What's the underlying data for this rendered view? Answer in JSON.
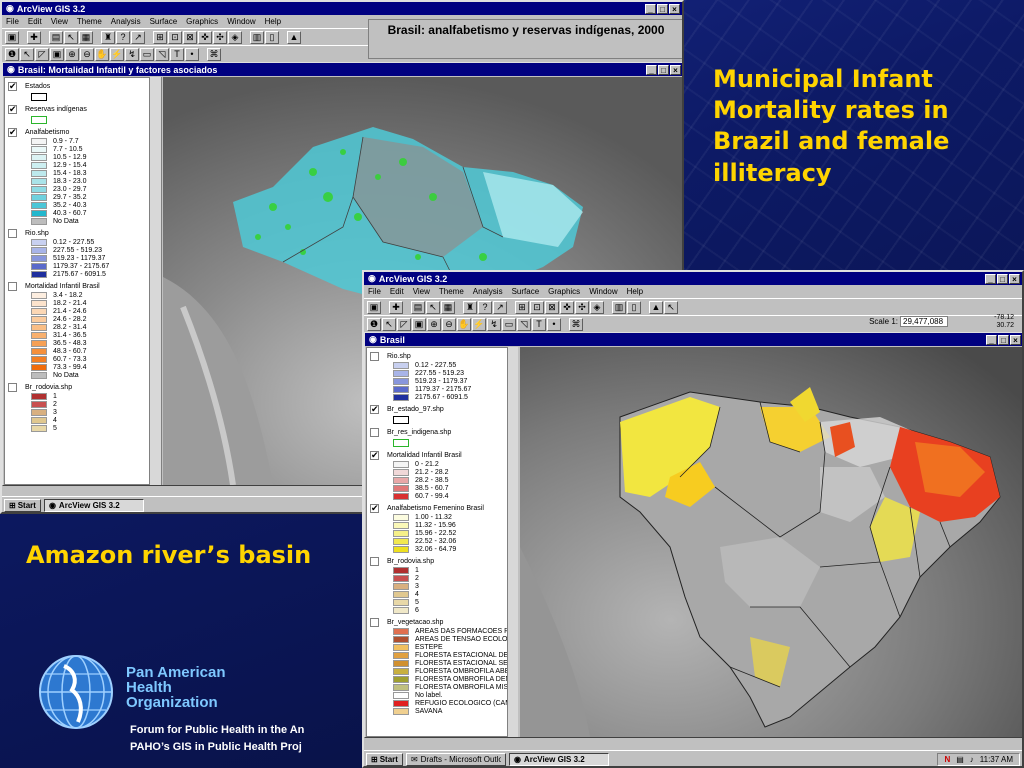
{
  "slide": {
    "heading": "Municipal Infant Mortality rates in Brazil and female illiteracy",
    "subtitle": "Amazon river’s basin",
    "org_line1": "Pan American",
    "org_line2": "Health",
    "org_line3": "Organization",
    "footer_line1": "Forum for Public Health in the An",
    "footer_line2": "PAHO’s GIS in Public Health Proj",
    "colors": {
      "text_accent": "#ffd400",
      "background": "#0d1a66",
      "org_accent": "#7ec8ff"
    }
  },
  "window1": {
    "title": "ArcView GIS 3.2",
    "menu": [
      "File",
      "Edit",
      "View",
      "Theme",
      "Analysis",
      "Surface",
      "Graphics",
      "Window",
      "Help"
    ],
    "map_title": "Brasil: analfabetismo y reservas indígenas, 2000",
    "child_title": "Brasil: Mortalidad Infantil y factores asociados",
    "legend": [
      {
        "name": "Estados",
        "checked": true,
        "symbol": "box"
      },
      {
        "name": "Reservas indígenas",
        "checked": true,
        "symbol": "green-box"
      },
      {
        "name": "Analfabetismo",
        "checked": true,
        "classes": [
          {
            "label": "0.9 - 7.7",
            "color": "#f4f4f4"
          },
          {
            "label": "7.7 - 10.5",
            "color": "#eaf8f8"
          },
          {
            "label": "10.5 - 12.9",
            "color": "#dcf3f4"
          },
          {
            "label": "12.9 - 15.4",
            "color": "#cdeff1"
          },
          {
            "label": "15.4 - 18.3",
            "color": "#bde9ed"
          },
          {
            "label": "18.3 - 23.0",
            "color": "#a9e3e9"
          },
          {
            "label": "23.0 - 29.7",
            "color": "#8edbe4"
          },
          {
            "label": "29.7 - 35.2",
            "color": "#6fd1de"
          },
          {
            "label": "35.2 - 40.3",
            "color": "#4cc6d7"
          },
          {
            "label": "40.3 - 60.7",
            "color": "#22b7cd"
          },
          {
            "label": "No Data",
            "color": "#bdbdbd"
          }
        ]
      },
      {
        "name": "Rio.shp",
        "checked": false,
        "classes": [
          {
            "label": "0.12 - 227.55",
            "color": "#c8d0f0"
          },
          {
            "label": "227.55 - 519.23",
            "color": "#a8b4e8"
          },
          {
            "label": "519.23 - 1179.37",
            "color": "#8896dc"
          },
          {
            "label": "1179.37 - 2175.67",
            "color": "#5a6acb"
          },
          {
            "label": "2175.67 - 6091.5",
            "color": "#1f2f9e"
          }
        ]
      },
      {
        "name": "Mortalidad Infantil Brasil",
        "checked": false,
        "classes": [
          {
            "label": "3.4 - 18.2",
            "color": "#fdeee0"
          },
          {
            "label": "18.2 - 21.4",
            "color": "#fce3cc"
          },
          {
            "label": "21.4 - 24.6",
            "color": "#fbd7b5"
          },
          {
            "label": "24.6 - 28.2",
            "color": "#facb9e"
          },
          {
            "label": "28.2 - 31.4",
            "color": "#f9be86"
          },
          {
            "label": "31.4 - 36.5",
            "color": "#f8b06e"
          },
          {
            "label": "36.5 - 48.3",
            "color": "#f6a055"
          },
          {
            "label": "48.3 - 60.7",
            "color": "#f5903c"
          },
          {
            "label": "60.7 - 73.3",
            "color": "#f37f24"
          },
          {
            "label": "73.3 - 99.4",
            "color": "#f06c0c"
          },
          {
            "label": "No Data",
            "color": "#bdbdbd"
          }
        ]
      },
      {
        "name": "Br_rodovia.shp",
        "checked": false,
        "classes": [
          {
            "label": "1",
            "color": "#b03030"
          },
          {
            "label": "2",
            "color": "#c85050"
          },
          {
            "label": "3",
            "color": "#d8b080"
          },
          {
            "label": "4",
            "color": "#e0c890"
          },
          {
            "label": "5",
            "color": "#e8d8a8"
          }
        ]
      }
    ],
    "taskbar": {
      "start": "Start",
      "tasks": [
        "ArcView GIS 3.2"
      ]
    }
  },
  "window2": {
    "title": "ArcView GIS 3.2",
    "menu": [
      "File",
      "Edit",
      "View",
      "Theme",
      "Analysis",
      "Surface",
      "Graphics",
      "Window",
      "Help"
    ],
    "scale_label": "Scale 1:",
    "scale_value": "29,477,088",
    "coord1": "-78.12",
    "coord2": "30.72",
    "child_title": "Brasil",
    "legend": [
      {
        "name": "Rio.shp",
        "checked": false,
        "classes": [
          {
            "label": "0.12 - 227.55",
            "color": "#c8d0f0"
          },
          {
            "label": "227.55 - 519.23",
            "color": "#a8b4e8"
          },
          {
            "label": "519.23 - 1179.37",
            "color": "#8896dc"
          },
          {
            "label": "1179.37 - 2175.67",
            "color": "#5a6acb"
          },
          {
            "label": "2175.67 - 6091.5",
            "color": "#1f2f9e"
          }
        ]
      },
      {
        "name": "Br_estado_97.shp",
        "checked": true,
        "symbol": "box"
      },
      {
        "name": "Br_res_indigena.shp",
        "checked": false,
        "symbol": "green-box"
      },
      {
        "name": "Mortalidad Infantil Brasil",
        "checked": true,
        "classes": [
          {
            "label": "0 - 21.2",
            "color": "#f4f4f4"
          },
          {
            "label": "21.2 - 28.2",
            "color": "#f0d8d8"
          },
          {
            "label": "28.2 - 38.5",
            "color": "#e8a8a8"
          },
          {
            "label": "38.5 - 60.7",
            "color": "#e07878"
          },
          {
            "label": "60.7 - 99.4",
            "color": "#d83030"
          }
        ]
      },
      {
        "name": "Analfabetismo Femenino Brasil",
        "checked": true,
        "classes": [
          {
            "label": "1.00 - 11.32",
            "color": "#fcfce0"
          },
          {
            "label": "11.32 - 15.96",
            "color": "#faf8b8"
          },
          {
            "label": "15.96 - 22.52",
            "color": "#f6f088"
          },
          {
            "label": "22.52 - 32.06",
            "color": "#f2e850"
          },
          {
            "label": "32.06 - 64.79",
            "color": "#eee020"
          }
        ]
      },
      {
        "name": "Br_rodovia.shp",
        "checked": false,
        "classes": [
          {
            "label": "1",
            "color": "#b03030"
          },
          {
            "label": "2",
            "color": "#c85050"
          },
          {
            "label": "3",
            "color": "#d8b080"
          },
          {
            "label": "4",
            "color": "#e0c890"
          },
          {
            "label": "5",
            "color": "#e8d8a8"
          },
          {
            "label": "6",
            "color": "#f0e8c8"
          }
        ]
      },
      {
        "name": "Br_vegetacao.shp",
        "checked": false,
        "classes": [
          {
            "label": "AREAS DAS FORMACOES PI",
            "color": "#e07050"
          },
          {
            "label": "AREAS DE TENSAO ECOLOG",
            "color": "#b05030"
          },
          {
            "label": "ESTEPE",
            "color": "#f0c060"
          },
          {
            "label": "FLORESTA ESTACIONAL DE",
            "color": "#e0a040"
          },
          {
            "label": "FLORESTA ESTACIONAL SE",
            "color": "#d09030"
          },
          {
            "label": "FLORESTA OMBROFILA ABE",
            "color": "#c8b040"
          },
          {
            "label": "FLORESTA OMBROFILA DEN",
            "color": "#a0a030"
          },
          {
            "label": "FLORESTA OMBROFILA MIS",
            "color": "#c0c080"
          },
          {
            "label": "No label.",
            "color": "#ffffff"
          },
          {
            "label": "REFUGIO ECOLOGICO (CAM",
            "color": "#e02020"
          },
          {
            "label": "SAVANA",
            "color": "#f0d090"
          }
        ]
      }
    ],
    "taskbar": {
      "start": "Start",
      "tasks": [
        "Drafts - Microsoft Outlook",
        "ArcView GIS 3.2"
      ],
      "clock": "11:37 AM"
    }
  }
}
